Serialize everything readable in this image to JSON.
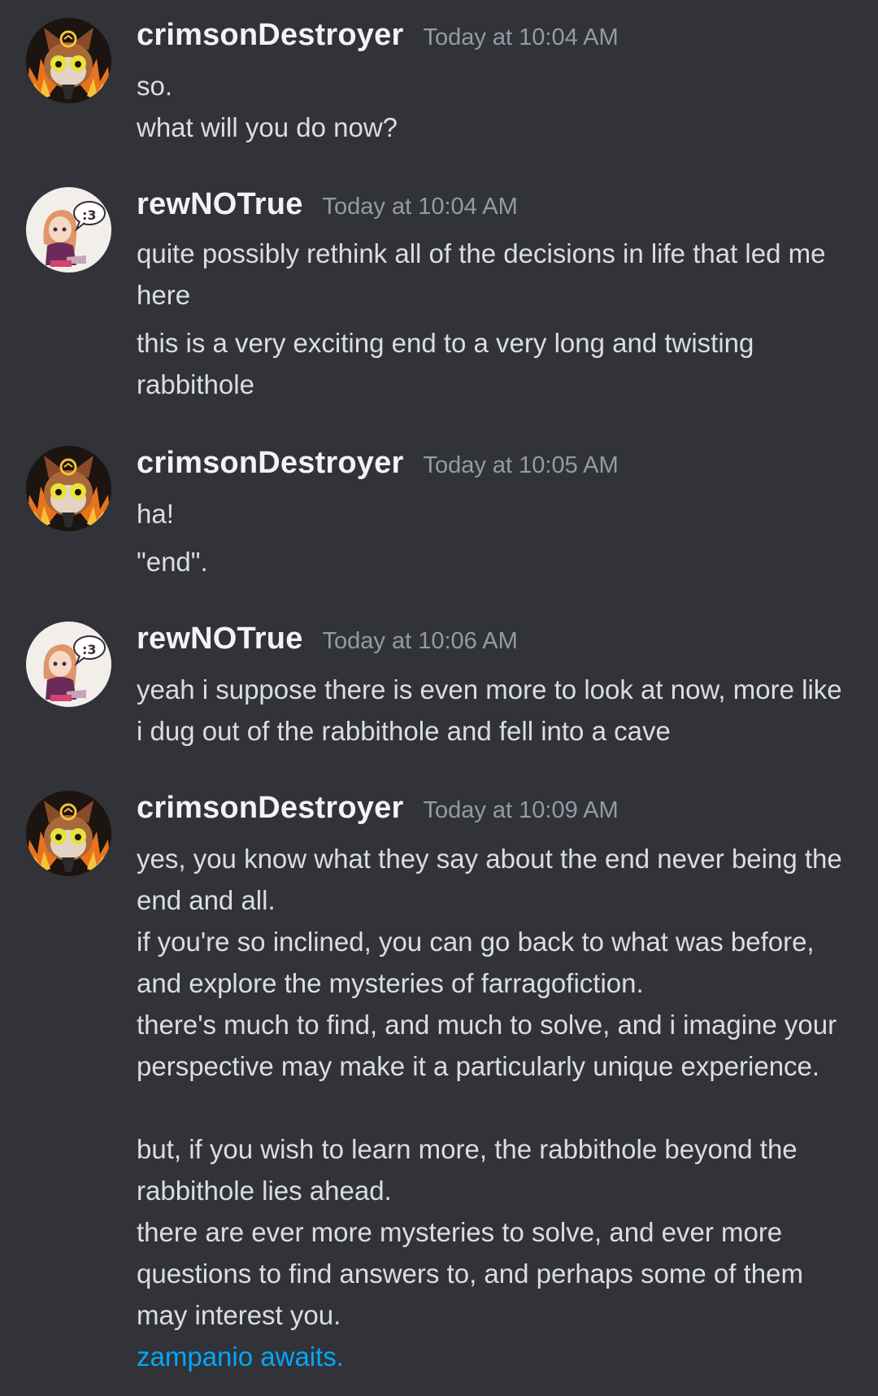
{
  "messages": [
    {
      "author": "crimsonDestroyer",
      "timestamp": "Today at 10:04 AM",
      "avatar": "cat-avatar",
      "lines": [
        "so.",
        "what will you do now?"
      ]
    },
    {
      "author": "rewNOTrue",
      "timestamp": "Today at 10:04 AM",
      "avatar": "girl-avatar",
      "lines": [
        "quite possibly rethink all of the decisions in life that led me here",
        "this is a very exciting end to a very long and twisting rabbithole"
      ]
    },
    {
      "author": "crimsonDestroyer",
      "timestamp": "Today at 10:05 AM",
      "avatar": "cat-avatar",
      "lines": [
        "ha!",
        "\"end\"."
      ]
    },
    {
      "author": "rewNOTrue",
      "timestamp": "Today at 10:06 AM",
      "avatar": "girl-avatar",
      "lines": [
        "yeah i suppose there is even more to look at now, more like i dug out of the rabbithole and fell into a cave"
      ]
    },
    {
      "author": "crimsonDestroyer",
      "timestamp": "Today at 10:09 AM",
      "avatar": "cat-avatar",
      "lines": [
        "yes, you know what they say about the end never being the end and all.",
        "if you're so inclined, you can go back to what was before, and explore the mysteries of farragofiction.",
        "there's much to find, and much to solve, and i imagine your perspective may make it a particularly unique experience.",
        "but, if you wish to learn more, the rabbithole beyond the rabbithole lies ahead.",
        "there are ever more mysteries to solve, and ever more questions to find answers to, and perhaps some of them may interest you."
      ],
      "link": "zampanio awaits."
    }
  ],
  "colors": {
    "background": "#313338",
    "username": "#f2f3f5",
    "timestamp": "#949ba4",
    "text": "#dbdee1",
    "link": "#00a8fc"
  }
}
